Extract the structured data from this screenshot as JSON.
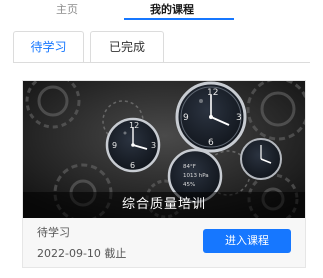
{
  "nav": {
    "home_label": "主页",
    "my_courses_label": "我的课程"
  },
  "tabs": {
    "pending_label": "待学习",
    "completed_label": "已完成"
  },
  "course": {
    "title": "综合质量培训",
    "status": "待学习",
    "deadline": "2022-09-10 截止",
    "enter_label": "进入课程",
    "cover_readouts": [
      "84°F",
      "1013 hPa",
      "45%"
    ]
  },
  "colors": {
    "accent": "#1677ff",
    "cover_background": "#1e1e1e"
  }
}
